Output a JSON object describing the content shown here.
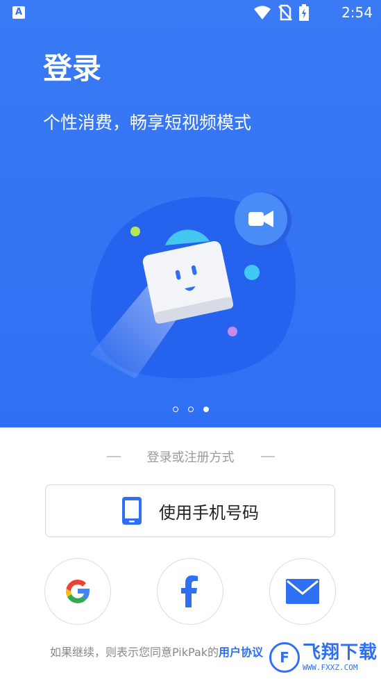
{
  "statusbar": {
    "time": "2:54"
  },
  "hero": {
    "title": "登录",
    "subtitle": "个性消费，畅享短视频模式",
    "pager": {
      "total": 3,
      "active_index": 2
    }
  },
  "login": {
    "divider_label": "登录或注册方式",
    "phone_button_label": "使用手机号码",
    "social": [
      {
        "name": "google",
        "icon": "google-icon"
      },
      {
        "name": "facebook",
        "icon": "facebook-icon"
      },
      {
        "name": "email",
        "icon": "mail-icon"
      }
    ]
  },
  "footer": {
    "prefix": "如果继续，则表示您同意PikPak的",
    "link": "用户协议"
  },
  "watermark": {
    "main": "飞翔下载",
    "sub": "WWW.FXXZ.COM"
  },
  "colors": {
    "primary": "#2f6ff3",
    "hero_bg": "#3a7af5"
  }
}
